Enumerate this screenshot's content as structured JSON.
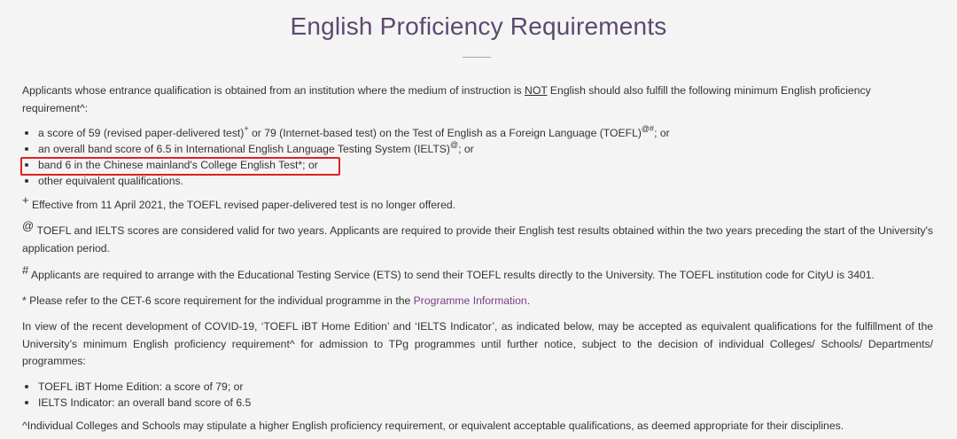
{
  "page": {
    "title": "English Proficiency Requirements"
  },
  "intro": {
    "text_before": "Applicants whose entrance qualification is obtained from an institution where the medium of instruction is ",
    "not_word": "NOT",
    "text_after": " English should also fulfill the following minimum English proficiency requirement^:"
  },
  "requirements": [
    {
      "before": "a score of 59 (revised paper-delivered test)",
      "sup1": "+",
      "after": " or 79 (Internet-based test) on the Test of English as a Foreign Language (TOEFL)",
      "sup2": "@#",
      "tail": "; or"
    },
    {
      "before": "an overall band score of 6.5 in International English Language Testing System (IELTS)",
      "sup1": "@",
      "after": "; or"
    },
    {
      "text": "band 6 in the Chinese mainland's College English Test*; or"
    },
    {
      "text": "other equivalent qualifications."
    }
  ],
  "notes": {
    "plus": {
      "symbol": "+",
      "text": " Effective from 11 April 2021, the TOEFL revised paper-delivered test is no longer offered."
    },
    "at": {
      "symbol": "@",
      "text": " TOEFL and IELTS scores are considered valid for two years. Applicants are required to provide their English test results obtained within the two years preceding the start of the University's application period."
    },
    "hash": {
      "symbol": "#",
      "text": " Applicants are required to arrange with the Educational Testing Service (ETS) to send their TOEFL results directly to the University. The TOEFL institution code for CityU is 3401."
    },
    "star": {
      "text_before": "* Please refer to the CET-6 score requirement for the individual programme in the ",
      "link": "Programme Information",
      "text_after": "."
    }
  },
  "covid": {
    "text": "In view of the recent development of COVID-19, ‘TOEFL iBT Home Edition’ and ‘IELTS Indicator’, as indicated below, may be accepted as equivalent qualifications for the fulfillment of the University’s minimum English proficiency requirement^ for admission to TPg programmes until further notice, subject to the decision of individual Colleges/ Schools/ Departments/ programmes:",
    "items": [
      "TOEFL iBT Home Edition: a score of 79; or",
      "IELTS Indicator: an overall band score of 6.5"
    ]
  },
  "footer": {
    "text": "^Individual Colleges and Schools may stipulate a higher English proficiency requirement, or equivalent acceptable qualifications, as deemed appropriate for their disciplines."
  },
  "colors": {
    "title": "#5b4a6e",
    "link": "#7a3e8a",
    "highlight": "#e02020",
    "background": "#f4f4f4"
  }
}
